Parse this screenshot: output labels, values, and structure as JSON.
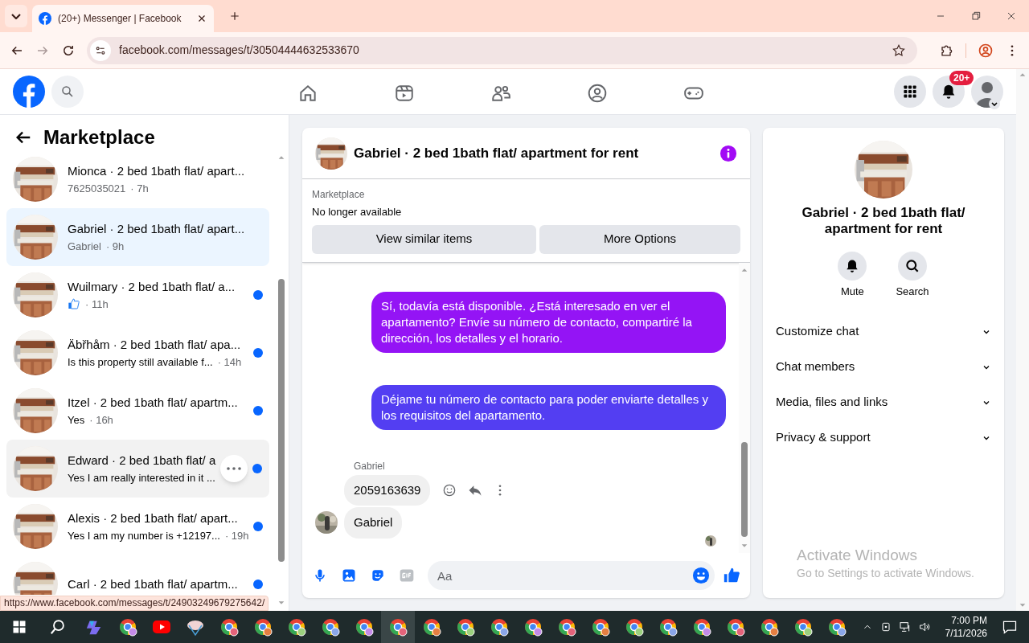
{
  "browser": {
    "tab_title": "(20+) Messenger | Facebook",
    "url": "facebook.com/messages/t/30504444632533670",
    "status_url": "https://www.facebook.com/messages/t/24903249679275642/"
  },
  "header": {
    "notification_badge": "20+"
  },
  "sidebar": {
    "title": "Marketplace",
    "conversations": [
      {
        "title": "Mionca · 2 bed 1bath flat/ apart...",
        "kind": "text",
        "preview": "7625035021",
        "time": "· 7h",
        "unread": false,
        "selected": false,
        "hovered": false
      },
      {
        "title": "Gabriel · 2 bed 1bath flat/ apart...",
        "kind": "text",
        "preview": "Gabriel",
        "time": "· 9h",
        "unread": false,
        "selected": true,
        "hovered": false
      },
      {
        "title": "Wuilmary · 2 bed 1bath flat/ a...",
        "kind": "like",
        "time": "· 11h",
        "unread": true,
        "selected": false,
        "hovered": false
      },
      {
        "title": "Äbřhåm · 2 bed 1bath flat/ apa...",
        "kind": "text",
        "preview": "Is this property still available f...",
        "time": "· 14h",
        "unread": true,
        "selected": false,
        "hovered": false
      },
      {
        "title": "Itzel · 2 bed 1bath flat/ apartm...",
        "kind": "text",
        "preview": "Yes",
        "time": "· 16h",
        "unread": true,
        "selected": false,
        "hovered": false
      },
      {
        "title": "Edward · 2 bed 1bath flat/ a",
        "kind": "text",
        "preview": "Yes I am really interested in it ...",
        "unread": true,
        "selected": false,
        "hovered": true
      },
      {
        "title": "Alexis · 2 bed 1bath flat/ apart...",
        "kind": "text",
        "preview": "Yes I am my number is +12197...",
        "time": "· 19h",
        "unread": true,
        "selected": false,
        "hovered": false
      },
      {
        "title": "Carl · 2 bed 1bath flat/ apartm...",
        "unread": true,
        "selected": false,
        "hovered": false
      }
    ]
  },
  "chat": {
    "title": "Gabriel · 2 bed 1bath flat/ apartment for rent",
    "listing_label": "Marketplace",
    "listing_status": "No longer available",
    "buttons": [
      "View similar items",
      "More Options"
    ],
    "messages": [
      {
        "kind": "outgoing",
        "text": "Sí, todavía está disponible. ¿Está interesado en ver el apartamento? Envíe su número de contacto, compartiré la dirección, los detalles y el horario.",
        "color": "#9414f5"
      },
      {
        "kind": "outgoing",
        "text": "Déjame tu número de contacto para poder enviarte detalles y los requisitos del apartamento.",
        "color": "#533ef2"
      },
      {
        "kind": "sender",
        "text": "Gabriel"
      },
      {
        "kind": "incoming",
        "text": "2059163639",
        "actions": true
      },
      {
        "kind": "incoming",
        "text": "Gabriel",
        "avatar": true
      }
    ],
    "composer_placeholder": "Aa"
  },
  "info_panel": {
    "title": "Gabriel · 2 bed 1bath flat/ apartment for rent",
    "actions": [
      {
        "kind": "mute",
        "label": "Mute"
      },
      {
        "kind": "search",
        "label": "Search"
      }
    ],
    "sections": [
      {
        "label": "Customize chat",
        "expanded": false
      },
      {
        "label": "Chat members",
        "expanded": false
      },
      {
        "label": "Media, files and links",
        "expanded": false
      },
      {
        "label": "Privacy & support",
        "expanded": false
      }
    ]
  },
  "os_overlay": {
    "title": "Activate Windows",
    "subtitle": "Go to Settings to activate Windows."
  },
  "taskbar": {
    "time": "7:00 PM",
    "date": "7/11/2026"
  }
}
